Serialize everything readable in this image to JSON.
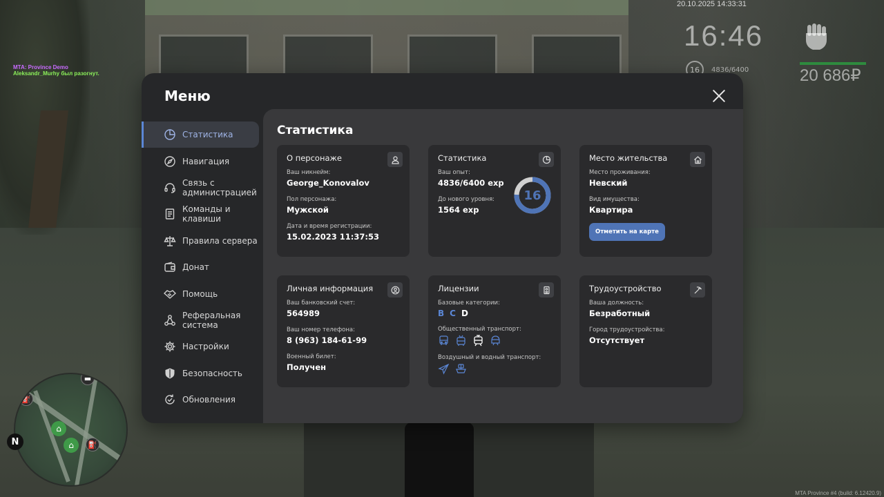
{
  "hud": {
    "chat_lines": [
      "MTA: Province Demo",
      "Aleksandr_Murhy был разогнут."
    ],
    "datetime": "20.10.2025 14:33:31",
    "time": "16:46",
    "level": "16",
    "exp": "4836/6400",
    "money": "20 686₽",
    "build": "MTA Province #4 (build: 6.12420.9)"
  },
  "menu": {
    "title": "Меню",
    "sidebar": [
      {
        "label": "Статистика",
        "icon": "pie-chart-icon",
        "active": true
      },
      {
        "label": "Навигация",
        "icon": "compass-icon"
      },
      {
        "label": "Связь с администрацией",
        "icon": "headset-icon"
      },
      {
        "label": "Команды и клавиши",
        "icon": "document-icon"
      },
      {
        "label": "Правила сервера",
        "icon": "scales-icon"
      },
      {
        "label": "Донат",
        "icon": "wallet-icon"
      },
      {
        "label": "Помощь",
        "icon": "handshake-icon"
      },
      {
        "label": "Реферальная система",
        "icon": "network-icon"
      },
      {
        "label": "Настройки",
        "icon": "gear-icon"
      },
      {
        "label": "Безопасность",
        "icon": "shield-icon"
      },
      {
        "label": "Обновления",
        "icon": "refresh-check-icon"
      }
    ],
    "content_title": "Статистика",
    "cards": {
      "character": {
        "title": "О персонаже",
        "nickname_label": "Ваш никнейм:",
        "nickname": "George_Konovalov",
        "gender_label": "Пол персонажа:",
        "gender": "Мужской",
        "reg_label": "Дата и время регистрации:",
        "reg": "15.02.2023 11:37:53"
      },
      "stats": {
        "title": "Статистика",
        "exp_label": "Ваш опыт:",
        "exp": "4836/6400 exp",
        "next_label": "До нового уровня:",
        "next": "1564 exp",
        "level": "16",
        "progress": 0.7556
      },
      "residence": {
        "title": "Место жительства",
        "place_label": "Место проживания:",
        "place": "Невский",
        "property_label": "Вид имущества:",
        "property": "Квартира",
        "button": "Отметить на карте"
      },
      "personal": {
        "title": "Личная информация",
        "bank_label": "Ваш банковский счет:",
        "bank": "564989",
        "phone_label": "Ваш номер телефона:",
        "phone": "8 (963) 184-61-99",
        "military_label": "Военный билет:",
        "military": "Получен"
      },
      "licenses": {
        "title": "Лицензии",
        "base_label": "Базовые категории:",
        "categories": [
          "B",
          "C",
          "D"
        ],
        "public_label": "Общественный транспорт:",
        "air_label": "Воздушный и водный транспорт:"
      },
      "employment": {
        "title": "Трудоустройство",
        "position_label": "Ваша должность:",
        "position": "Безработный",
        "city_label": "Город трудоустройства:",
        "city": "Отсутствует"
      }
    }
  },
  "colors": {
    "accent": "#4f74b6",
    "active_text": "#9fb4e6",
    "panel": "#262729",
    "content": "#39393b",
    "card": "#2a2a2c"
  }
}
